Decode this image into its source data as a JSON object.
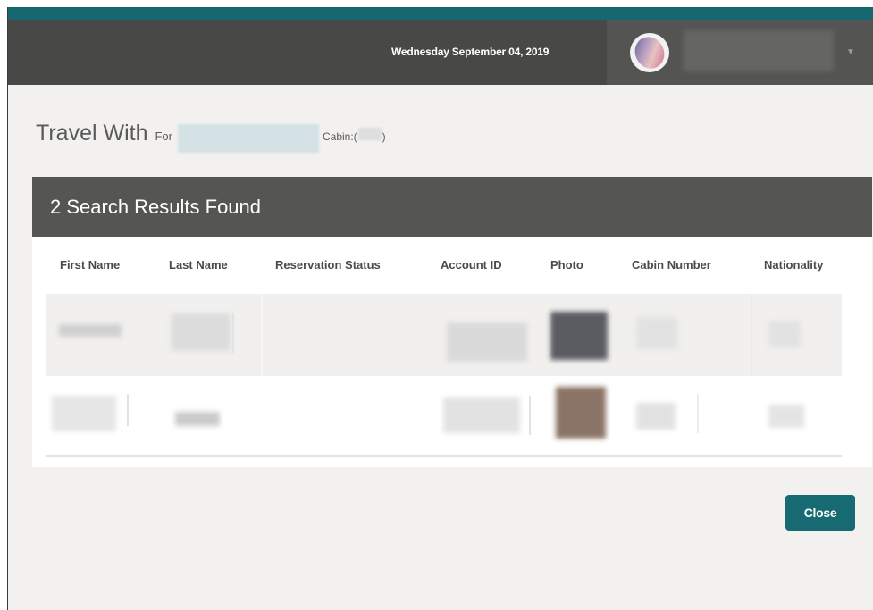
{
  "header": {
    "date": "Wednesday September 04, 2019",
    "dropdown_icon": "caret-down-icon"
  },
  "dialog": {
    "title": "Travel With",
    "for_label": "For",
    "cabin_prefix": "Cabin:(",
    "cabin_suffix": ")"
  },
  "results": {
    "heading": "2 Search Results Found",
    "columns": [
      "First Name",
      "Last Name",
      "Reservation Status",
      "Account ID",
      "Photo",
      "Cabin Number",
      "Nationality"
    ],
    "row_count": 2
  },
  "actions": {
    "close_label": "Close",
    "close_color": "#186a72"
  },
  "colors": {
    "accent": "#176770",
    "topbar": "#484846",
    "panel_header": "#555553",
    "content_bg": "#f2f1ef"
  }
}
